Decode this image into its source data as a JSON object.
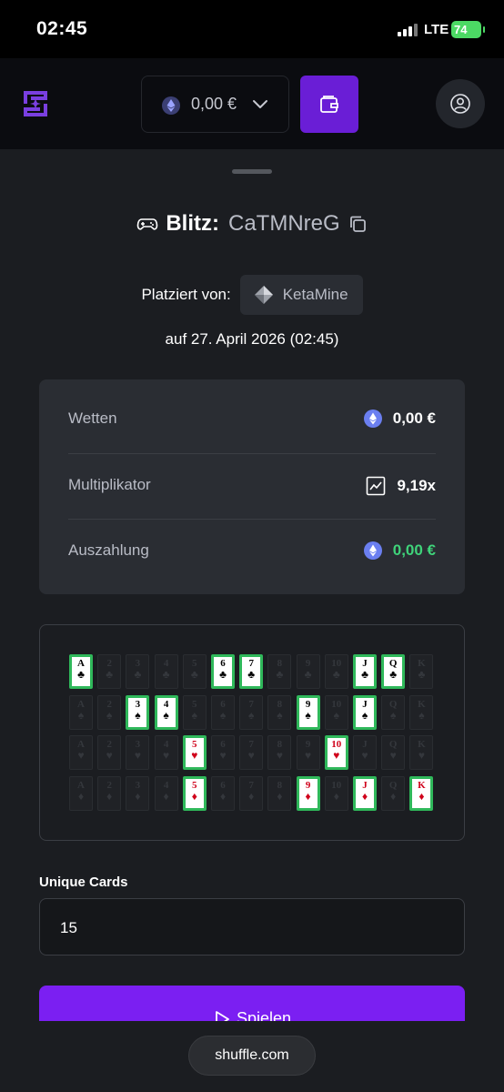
{
  "status": {
    "time": "02:45",
    "network": "LTE",
    "battery": "74"
  },
  "header": {
    "balance": "0,00 €",
    "wallet_icon": "wallet-icon",
    "profile_icon": "user-icon",
    "logo_icon": "shuffle-logo"
  },
  "bet": {
    "game": "Blitz:",
    "bet_id": "CaTMNreG",
    "placed_by_label": "Platziert von:",
    "user": "KetaMine",
    "date": "auf 27. April 2026 (02:45)"
  },
  "stats": [
    {
      "label": "Wetten",
      "value": "0,00 €",
      "icon": "eth-icon"
    },
    {
      "label": "Multiplikator",
      "value": "9,19x",
      "icon": "trend-chart-icon"
    },
    {
      "label": "Auszahlung",
      "value": "0,00 €",
      "icon": "eth-icon"
    }
  ],
  "board": {
    "ranks": [
      "A",
      "2",
      "3",
      "4",
      "5",
      "6",
      "7",
      "8",
      "9",
      "10",
      "J",
      "Q",
      "K"
    ],
    "suits": [
      {
        "symbol": "♣",
        "color": "black"
      },
      {
        "symbol": "♠",
        "color": "black"
      },
      {
        "symbol": "♥",
        "color": "red"
      },
      {
        "symbol": "♦",
        "color": "red"
      }
    ],
    "selected": [
      [
        0,
        5,
        6,
        10,
        11
      ],
      [
        2,
        3,
        8,
        10
      ],
      [
        4,
        9
      ],
      [
        4,
        8,
        10,
        12
      ]
    ],
    "selected_border_color": "#2fb85a"
  },
  "unique_cards": {
    "label": "Unique Cards",
    "value": "15"
  },
  "play_button": {
    "label": "Spielen",
    "color": "#7b1ff2"
  },
  "browser": {
    "url": "shuffle.com"
  }
}
